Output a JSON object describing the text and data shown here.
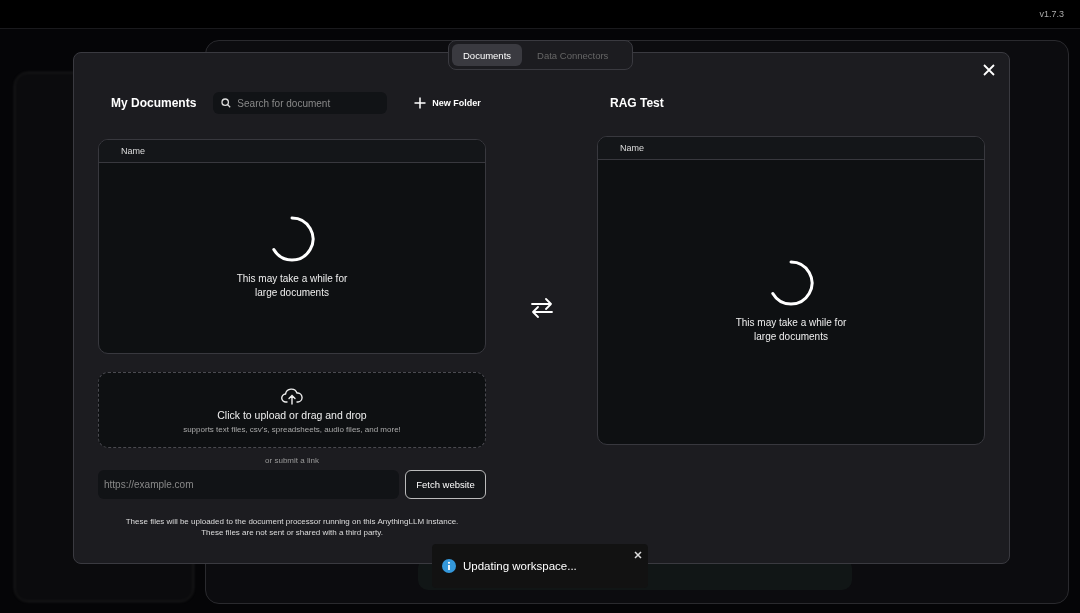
{
  "version": "v1.7.3",
  "tabs": [
    {
      "label": "Documents",
      "selected": true
    },
    {
      "label": "Data Connectors",
      "selected": false
    }
  ],
  "my_documents": {
    "title": "My Documents",
    "search": {
      "placeholder": "Search for document"
    },
    "new_folder": "New Folder",
    "table": {
      "columns": [
        "Name"
      ],
      "loading_text": [
        "This may take a while for",
        "large documents"
      ]
    },
    "upload": {
      "title": "Click to upload or drag and drop",
      "subtitle": "supports text files, csv's, spreadsheets, audio files, and more!"
    },
    "link_divider": "or submit a link",
    "url_field": {
      "placeholder": "https://example.com"
    },
    "fetch_button": "Fetch website",
    "notice": [
      "These files will be uploaded to the document processor running on this AnythingLLM instance.",
      "These files are not sent or shared with a third party."
    ]
  },
  "workspace": {
    "title": "RAG Test",
    "table": {
      "columns": [
        "Name"
      ],
      "loading_text": [
        "This may take a while for",
        "large documents"
      ]
    }
  },
  "toast": {
    "message": "Updating workspace..."
  }
}
